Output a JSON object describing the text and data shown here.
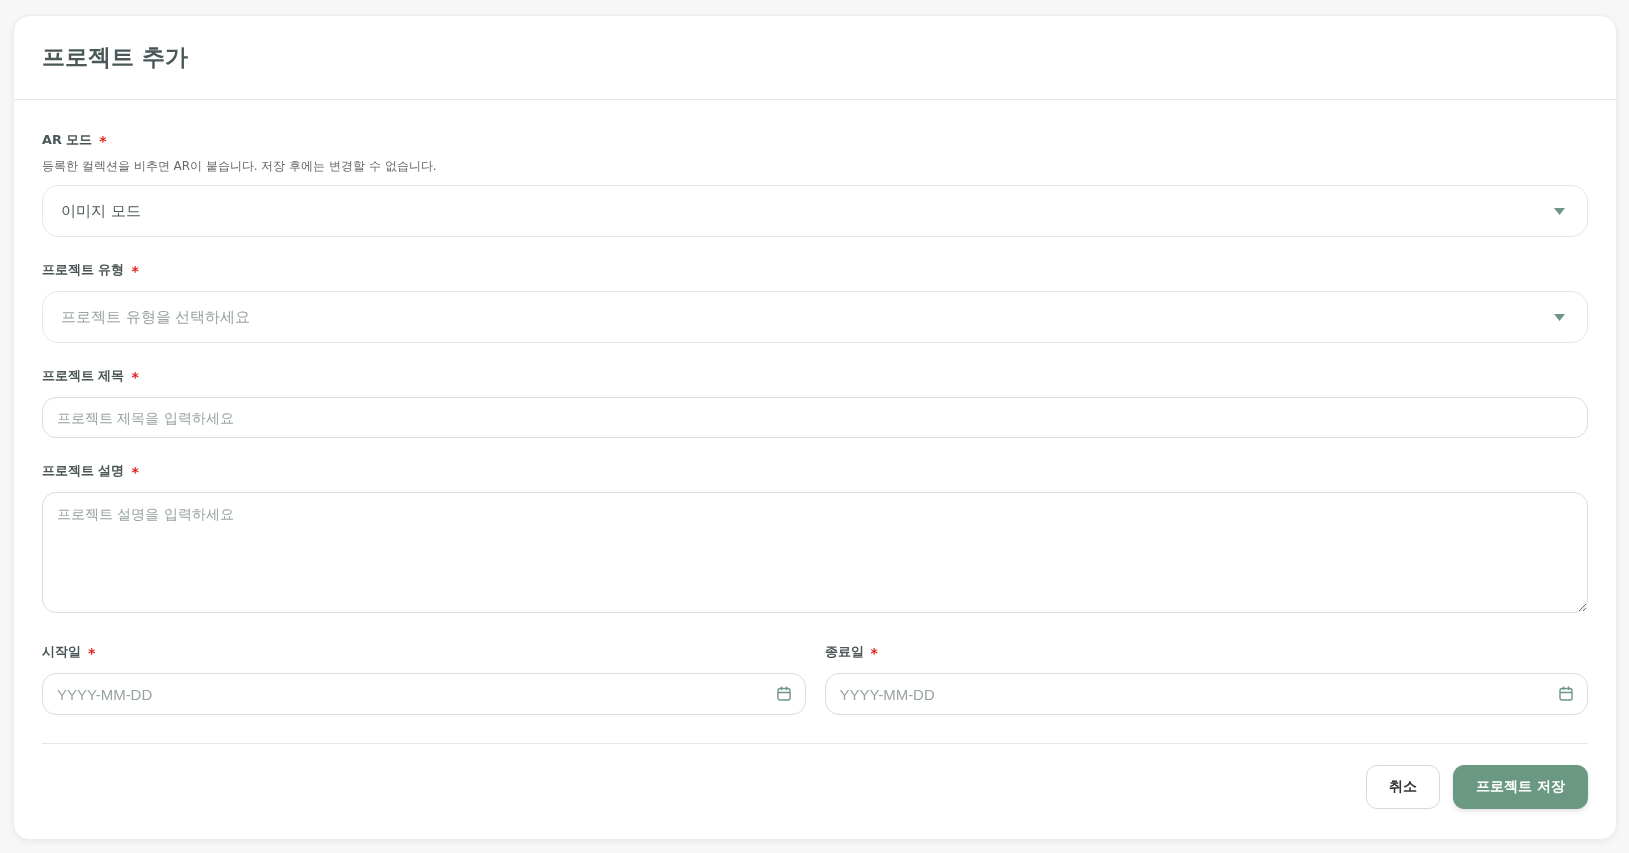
{
  "title": "프로젝트 추가",
  "fields": [
    {
      "kind": "select",
      "label": "AR 모드",
      "required_mark": "*",
      "description": "등록한 컬렉션을 비추면 AR이 붙습니다. 저장 후에는 변경할 수 없습니다.",
      "value": "이미지 모드"
    },
    {
      "kind": "select",
      "label": "프로젝트 유형",
      "required_mark": "*",
      "placeholder": "프로젝트 유형을 선택하세요"
    },
    {
      "kind": "text",
      "label": "프로젝트 제목",
      "required_mark": "*",
      "placeholder": "프로젝트 제목을 입력하세요"
    },
    {
      "kind": "textarea",
      "label": "프로젝트 설명",
      "required_mark": "*",
      "placeholder": "프로젝트 설명을 입력하세요"
    }
  ],
  "date_fields": [
    {
      "kind": "date",
      "label": "시작일",
      "required_mark": "*",
      "placeholder": "YYYY-MM-DD"
    },
    {
      "kind": "date",
      "label": "종료일",
      "required_mark": "*",
      "placeholder": "YYYY-MM-DD"
    }
  ],
  "buttons": [
    {
      "label": "취소",
      "kind": "secondary"
    },
    {
      "label": "프로젝트 저장",
      "kind": "primary"
    }
  ]
}
